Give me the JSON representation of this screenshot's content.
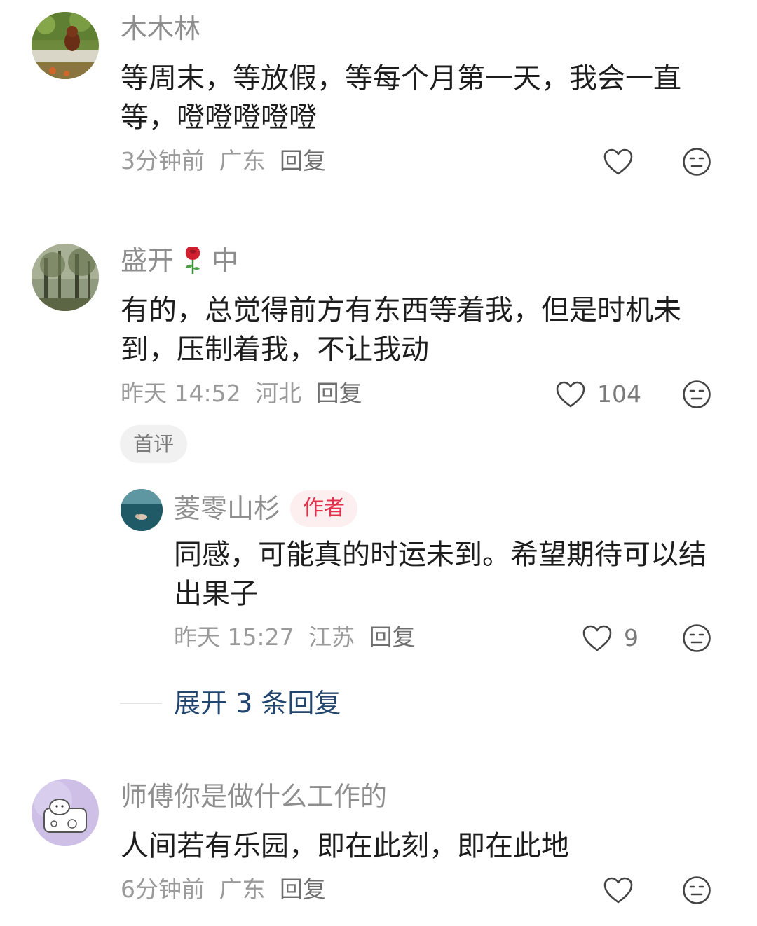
{
  "comments": [
    {
      "username": "木木林",
      "text": "等周末，等放假，等每个月第一天，我会一直等，噔噔噔噔噔",
      "time": "3分钟前",
      "location": "广东",
      "reply_label": "回复",
      "likes": ""
    },
    {
      "username": "盛开",
      "username_suffix": "中",
      "text": "有的，总觉得前方有东西等着我，但是时机未到，压制着我，不让我动",
      "time": "昨天 14:52",
      "location": "河北",
      "reply_label": "回复",
      "likes": "104",
      "tag": "首评",
      "replies": [
        {
          "username": "菱零山杉",
          "badge": "作者",
          "text": "同感，可能真的时运未到。希望期待可以结出果子",
          "time": "昨天 15:27",
          "location": "江苏",
          "reply_label": "回复",
          "likes": "9"
        }
      ],
      "expand_label": "展开 3 条回复"
    },
    {
      "username": "师傅你是做什么工作的",
      "text": "人间若有乐园，即在此刻，即在此地",
      "time": "6分钟前",
      "location": "广东",
      "reply_label": "回复",
      "likes": ""
    }
  ],
  "icons": {
    "like": "heart-outline-icon",
    "dislike": "neutral-face-icon",
    "rose": "rose-emoji"
  },
  "colors": {
    "username": "#8e8e8e",
    "link": "#23466f",
    "author_badge_text": "#e3324d",
    "author_badge_bg": "#fdeef0"
  }
}
